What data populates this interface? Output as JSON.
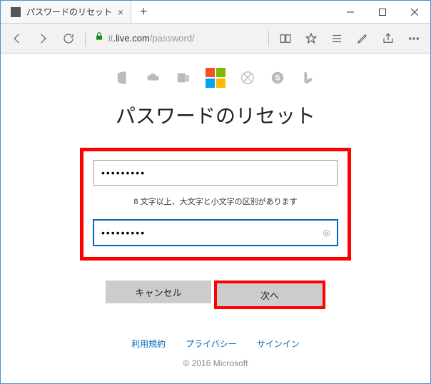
{
  "window": {
    "tab_title": "パスワードのリセット",
    "url_prefix": "it",
    "url_host": ".live.com",
    "url_path": "/password/"
  },
  "page": {
    "title": "パスワードのリセット",
    "password1": "•••••••••",
    "password2": "•••••••••",
    "hint": "8 文字以上、大文字と小文字の区別があります",
    "cancel": "キャンセル",
    "next": "次へ"
  },
  "footer": {
    "terms": "利用規約",
    "privacy": "プライバシー",
    "signin": "サインイン",
    "copyright": "© 2016 Microsoft"
  }
}
